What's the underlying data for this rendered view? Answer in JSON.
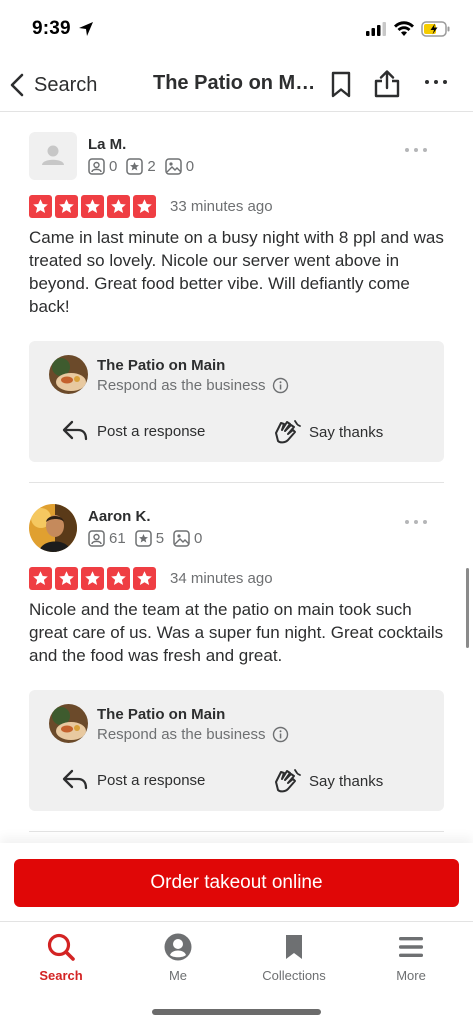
{
  "status_bar": {
    "time": "9:39"
  },
  "nav": {
    "back_label": "Search",
    "title": "The Patio on Main"
  },
  "reviews": [
    {
      "name": "La M.",
      "friends": "0",
      "reviews_count": "2",
      "photos": "0",
      "rating": 5,
      "time": "33 minutes ago",
      "text": "Came in last minute on a busy night with 8 ppl and was treated so lovely. Nicole our server went above in beyond. Great food better vibe. Will defiantly come back!",
      "business": {
        "name": "The Patio on Main",
        "subtitle": "Respond as the business",
        "post_label": "Post a response",
        "thanks_label": "Say thanks"
      }
    },
    {
      "name": "Aaron K.",
      "friends": "61",
      "reviews_count": "5",
      "photos": "0",
      "rating": 5,
      "time": "34 minutes ago",
      "text": "Nicole and the team at the patio on main took such great care of us. Was a super fun night. Great cocktails and the food was fresh and great.",
      "business": {
        "name": "The Patio on Main",
        "subtitle": "Respond as the business",
        "post_label": "Post a response",
        "thanks_label": "Say thanks"
      }
    }
  ],
  "cta": {
    "label": "Order takeout online"
  },
  "tabs": [
    {
      "label": "Search",
      "icon": "search-icon",
      "active": true
    },
    {
      "label": "Me",
      "icon": "profile-icon",
      "active": false
    },
    {
      "label": "Collections",
      "icon": "bookmark-icon",
      "active": false
    },
    {
      "label": "More",
      "icon": "menu-icon",
      "active": false
    }
  ],
  "colors": {
    "brand_red": "#d32323",
    "star_red": "#ef3e43",
    "cta_red": "#e00707"
  }
}
